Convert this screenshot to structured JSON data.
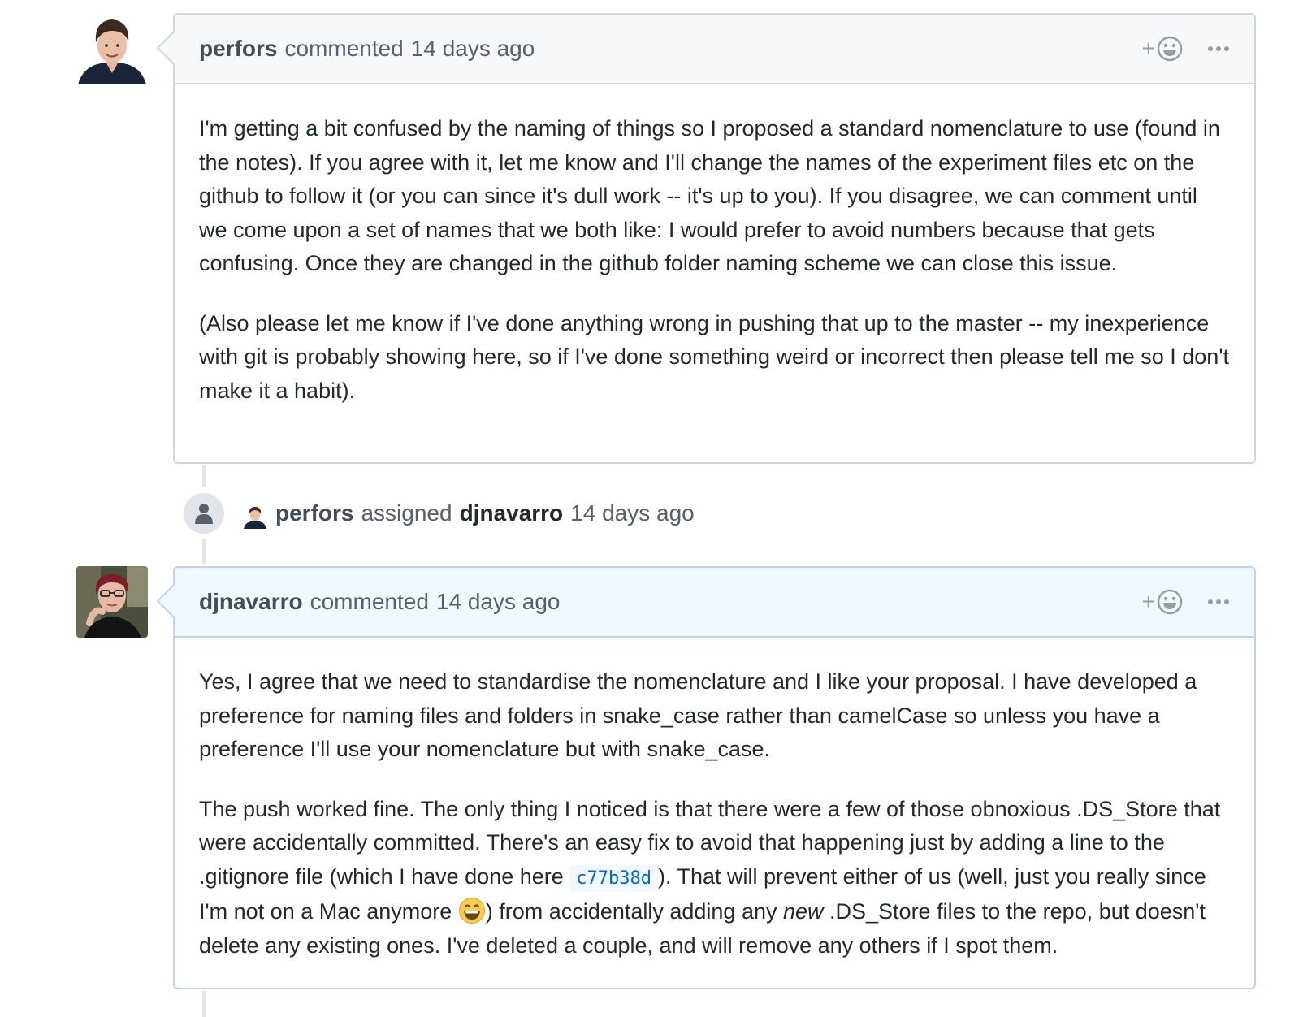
{
  "comments": [
    {
      "author": "perfors",
      "action": "commented",
      "timestamp": "14 days ago",
      "paragraphs": [
        "I'm getting a bit confused by the naming of things so I proposed a standard nomenclature to use (found in the notes). If you agree with it, let me know and I'll change the names of the experiment files etc on the github to follow it (or you can since it's dull work -- it's up to you). If you disagree, we can comment until we come upon a set of names that we both like: I would prefer to avoid numbers because that gets confusing. Once they are changed in the github folder naming scheme we can close this issue.",
        "(Also please let me know if I've done anything wrong in pushing that up to the master -- my inexperience with git is probably showing here, so if I've done something weird or incorrect then please tell me so I don't make it a habit)."
      ]
    },
    {
      "author": "djnavarro",
      "action": "commented",
      "timestamp": "14 days ago",
      "p1": "Yes, I agree that we need to standardise the nomenclature and I like your proposal. I have developed a preference for naming files and folders in snake_case rather than camelCase so unless you have a preference I'll use your nomenclature but with snake_case.",
      "p2_a": "The push worked fine. The only thing I noticed is that there were a few of those obnoxious .DS_Store that were accidentally committed. There's an easy fix to avoid that happening just by adding a line to the .gitignore file (which I have done here ",
      "commit_sha": "c77b38d",
      "p2_b": "). That will prevent either of us (well, just you really since I'm not on a Mac anymore ",
      "p2_c": ") from accidentally adding any ",
      "p2_em": "new",
      "p2_d": " .DS_Store files to the repo, but doesn't delete any existing ones. I've deleted a couple, and will remove any others if I spot them."
    }
  ],
  "event": {
    "actor": "perfors",
    "action": "assigned",
    "assignee": "djnavarro",
    "timestamp": "14 days ago"
  },
  "reaction_plus": "+",
  "colors": {
    "link": "#0366d6",
    "header_bg": "#f6f8fa",
    "header_bg_self": "#f1f8ff",
    "border": "#d1d5da"
  },
  "icons": [
    "smiley-icon",
    "kebab-icon",
    "person-icon",
    "grinning-emoji"
  ]
}
